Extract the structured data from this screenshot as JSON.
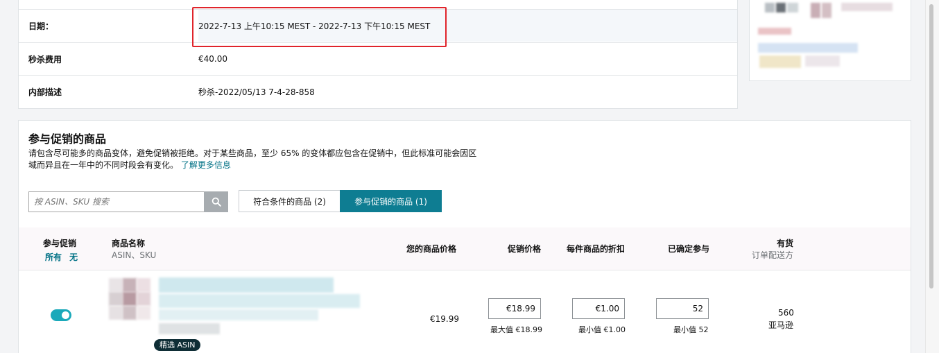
{
  "details": {
    "date_label": "日期：",
    "date_value": "2022-7-13 上午10:15 MEST - 2022-7-13 下午10:15 MEST",
    "fee_label": "秒杀费用",
    "fee_value": "€40.00",
    "desc_label": "内部描述",
    "desc_value": "秒杀-2022/05/13 7-4-28-858"
  },
  "products": {
    "title": "参与促销的商品",
    "description": "请包含尽可能多的商品变体，避免促销被拒绝。对于某些商品，至少 65% 的变体都应包含在促销中，但此标准可能会因区域而异且在一年中的不同时段会有变化。",
    "learn_more": "了解更多信息",
    "search_placeholder": "按 ASIN、SKU 搜索",
    "tabs": {
      "eligible": "符合条件的商品 (2)",
      "participating": "参与促销的商品 (1)"
    },
    "columns": {
      "participate": "参与促销",
      "select_all": "所有",
      "select_none": "无",
      "name": "商品名称",
      "name_sub": "ASIN、SKU",
      "your_price": "您的商品价格",
      "deal_price": "促销价格",
      "discount": "每件商品的折扣",
      "committed": "已确定参与",
      "available": "有货",
      "fulfillment": "订单配送方"
    },
    "rows": [
      {
        "badge": "精选 ASIN",
        "your_price": "€19.99",
        "deal_price": "€18.99",
        "deal_price_hint": "最大值 €18.99",
        "discount": "€1.00",
        "discount_hint": "最小值 €1.00",
        "committed": "52",
        "committed_hint": "最小值 52",
        "available": "560",
        "fulfillment": "亚马逊"
      }
    ]
  },
  "colors": {
    "accent": "#0e7d92",
    "toggle_on": "#1ba9ba",
    "highlight": "#e0242b"
  },
  "icons": [
    "search-icon"
  ]
}
